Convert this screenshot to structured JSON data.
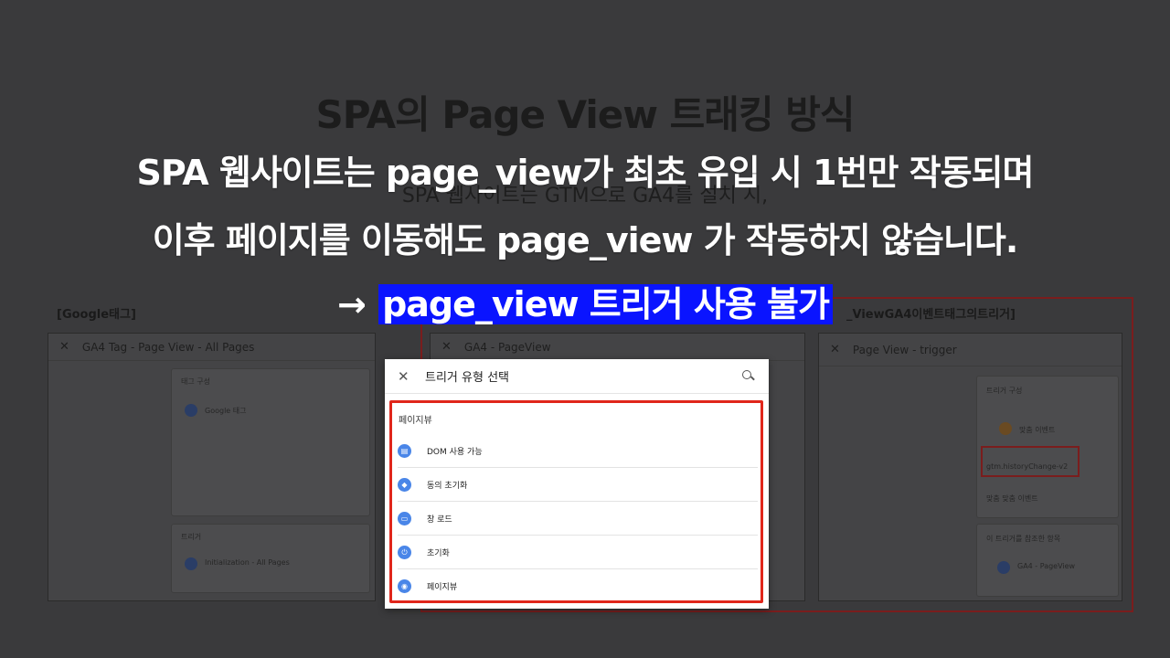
{
  "background": {
    "title": "SPA의 Page View 트래킹 방식",
    "subtitle": "SPA 웹사이트는 GTM으로 GA4를 설치 시,",
    "left_label": "[Google태그]",
    "right_label": "_ViewGA4이벤트태그의트리거]",
    "left_panel": {
      "header": "GA4 Tag - Page View - All Pages",
      "tag_section": "태그 구성",
      "tag_type": "Google 태그",
      "trigger_section": "트리거",
      "trigger_name": "Initialization - All Pages"
    },
    "middle_panel": {
      "header": "GA4 - PageView"
    },
    "right_panel": {
      "header": "Page View - trigger",
      "trigger_section": "트리거 구성",
      "trigger_type": "맞춤 이벤트",
      "event_name": "gtm.historyChange-v2",
      "match_label": "맞춤 맞춤 이벤트",
      "linked_section": "이 트리거를 참조한 항목",
      "linked_tag": "GA4 - PageView"
    }
  },
  "overlay": {
    "line1": "SPA 웹사이트는 page_view가 최초 유입 시 1번만 작동되며",
    "line2": "이후 페이지를 이동해도 page_view 가 작동하지 않습니다.",
    "arrow": "→",
    "highlight": "page_view 트리거 사용 불가",
    "highlight_color": "#0a14ff"
  },
  "dialog": {
    "close_icon": "close-icon",
    "title": "트리거 유형 선택",
    "section": "페이지뷰",
    "items": [
      {
        "icon": "document-icon",
        "label": "DOM 사용 가능"
      },
      {
        "icon": "shield-icon",
        "label": "동의 초기화"
      },
      {
        "icon": "window-icon",
        "label": "창 로드"
      },
      {
        "icon": "power-icon",
        "label": "초기화"
      },
      {
        "icon": "eye-icon",
        "label": "페이지뷰"
      }
    ],
    "accent_color": "#4a86e8",
    "highlight_border": "#e0261b"
  }
}
